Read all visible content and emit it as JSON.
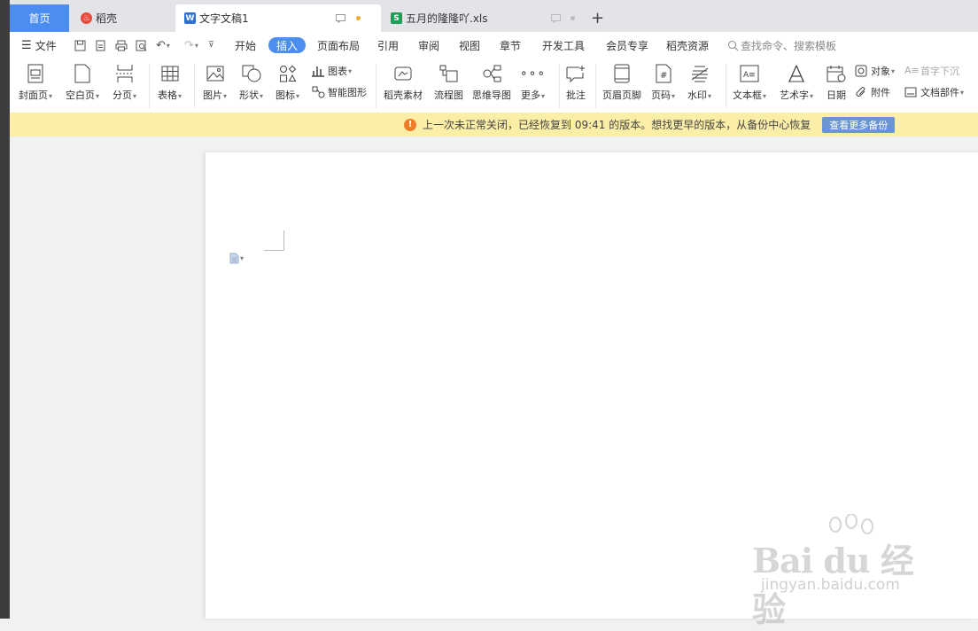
{
  "tabs": {
    "home": "首页",
    "daoke": "稻壳",
    "doc": "文字文稿1",
    "xls": "五月的隆隆吖.xls"
  },
  "menu": {
    "file": "文件",
    "items": [
      "开始",
      "插入",
      "页面布局",
      "引用",
      "审阅",
      "视图",
      "章节",
      "开发工具",
      "会员专享",
      "稻壳资源"
    ],
    "active": "插入",
    "search": "查找命令、搜索模板"
  },
  "ribbon": {
    "cover": "封面页",
    "blank": "空白页",
    "pagebreak": "分页",
    "table": "表格",
    "picture": "图片",
    "shape": "形状",
    "icon": "图标",
    "chart": "图表",
    "smartart": "智能图形",
    "material": "稻壳素材",
    "flowchart": "流程图",
    "mindmap": "思维导图",
    "more": "更多",
    "comment": "批注",
    "headerfooter": "页眉页脚",
    "pagenum": "页码",
    "watermark": "水印",
    "textbox": "文本框",
    "wordart": "艺术字",
    "date": "日期",
    "object": "对象",
    "attachment": "附件",
    "dropcap": "首字下沉",
    "docpart": "文档部件"
  },
  "notice": {
    "text": "上一次未正常关闭，已经恢复到 09:41 的版本。想找更早的版本，从备份中心恢复",
    "button": "查看更多备份"
  },
  "watermark": {
    "brand": "Bai du 经验",
    "url": "jingyan.baidu.com"
  },
  "colors": {
    "accent": "#4b8ef0",
    "notice_bg": "#fbeea7",
    "warn": "#ef7c28"
  }
}
